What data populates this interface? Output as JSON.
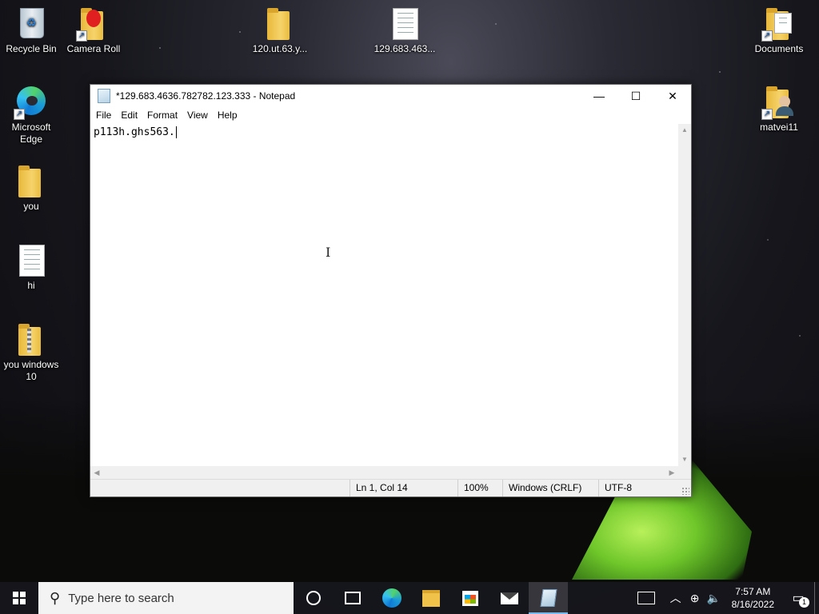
{
  "desktop": {
    "icons": [
      {
        "label": "Recycle Bin",
        "icon": "recycle-bin-icon"
      },
      {
        "label": "Camera Roll",
        "icon": "folder-shortcut-icon"
      },
      {
        "label": "120.ut.63.y...",
        "icon": "folder-icon"
      },
      {
        "label": "129.683.463...",
        "icon": "text-file-icon"
      },
      {
        "label": "Documents",
        "icon": "folder-shortcut-icon"
      },
      {
        "label": "Microsoft Edge",
        "icon": "edge-icon"
      },
      {
        "label": "matvei11",
        "icon": "user-folder-icon"
      },
      {
        "label": "you",
        "icon": "folder-icon"
      },
      {
        "label": "hi",
        "icon": "text-file-icon"
      },
      {
        "label": "you windows 10",
        "icon": "zip-folder-icon"
      }
    ]
  },
  "notepad": {
    "title": "*129.683.4636.782782.123.333 - Notepad",
    "menu": [
      "File",
      "Edit",
      "Format",
      "View",
      "Help"
    ],
    "content": "p113h.ghs563.",
    "status": {
      "position": "Ln 1, Col 14",
      "zoom": "100%",
      "line_endings": "Windows (CRLF)",
      "encoding": "UTF-8"
    },
    "buttons": {
      "minimize": "—",
      "maximize": "☐",
      "close": "✕"
    }
  },
  "taskbar": {
    "search_placeholder": "Type here to search",
    "pinned": [
      "cortana",
      "task-view",
      "microsoft-edge",
      "file-explorer",
      "microsoft-store",
      "mail",
      "notepad"
    ],
    "active_app": "notepad",
    "clock": {
      "time": "7:57 AM",
      "date": "8/16/2022"
    },
    "notification_count": "1"
  }
}
